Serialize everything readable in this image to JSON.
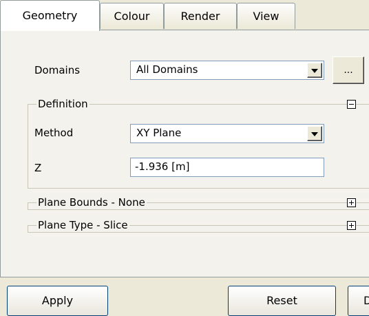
{
  "tabs": [
    {
      "label": "Geometry",
      "active": true
    },
    {
      "label": "Colour",
      "active": false
    },
    {
      "label": "Render",
      "active": false
    },
    {
      "label": "View",
      "active": false
    }
  ],
  "domains": {
    "label": "Domains",
    "selected": "All Domains",
    "browse_label": "..."
  },
  "definition": {
    "legend": "Definition",
    "expanded": true,
    "method": {
      "label": "Method",
      "selected": "XY Plane"
    },
    "z": {
      "label": "Z",
      "value": "-1.936 [m]"
    }
  },
  "plane_bounds": {
    "legend": "Plane Bounds - None",
    "expanded": false
  },
  "plane_type": {
    "legend": "Plane Type - Slice",
    "expanded": false
  },
  "buttons": {
    "apply": "Apply",
    "reset": "Reset",
    "partial": "D"
  }
}
